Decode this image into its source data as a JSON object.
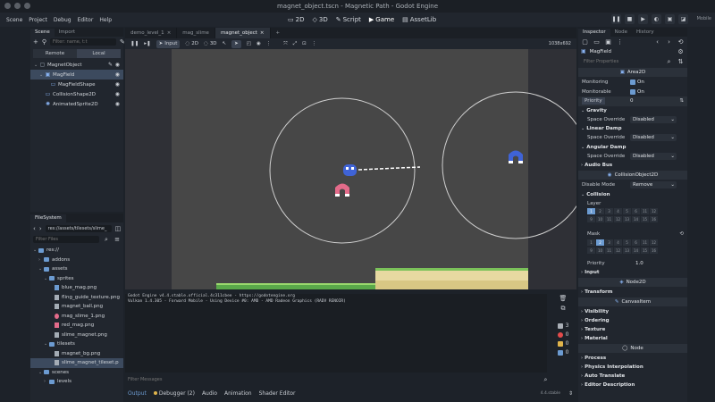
{
  "window": {
    "title": "magnet_object.tscn - Magnetic Path - Godot Engine"
  },
  "menu": [
    "Scene",
    "Project",
    "Debug",
    "Editor",
    "Help"
  ],
  "workspaces": [
    {
      "label": "2D",
      "icon": "2d-icon"
    },
    {
      "label": "3D",
      "icon": "3d-icon"
    },
    {
      "label": "Script",
      "icon": "script-icon"
    },
    {
      "label": "Game",
      "icon": "game-icon"
    },
    {
      "label": "AssetLib",
      "icon": "assetlib-icon"
    }
  ],
  "renderer": "Mobile",
  "scene_dock": {
    "tabs": [
      "Scene",
      "Import"
    ],
    "filter_placeholder": "Filter: name, t:t",
    "remote_label": "Remote",
    "local_label": "Local",
    "nodes": [
      {
        "name": "MagnetObject",
        "depth": 0,
        "icon_color": "#a8b3c2"
      },
      {
        "name": "MagField",
        "depth": 1,
        "icon_color": "#88b2f1"
      },
      {
        "name": "MagFieldShape",
        "depth": 2,
        "icon_color": "#88b2f1"
      },
      {
        "name": "CollisionShape2D",
        "depth": 1,
        "icon_color": "#88b2f1"
      },
      {
        "name": "AnimatedSprite2D",
        "depth": 1,
        "icon_color": "#88b2f1"
      }
    ]
  },
  "filesystem": {
    "tab": "FileSystem",
    "path": "res://assets/tilesets/slime_",
    "filter_placeholder": "Filter Files",
    "items": [
      {
        "name": "res://",
        "type": "folder",
        "depth": 0
      },
      {
        "name": "addons",
        "type": "folder",
        "depth": 1
      },
      {
        "name": "assets",
        "type": "folder",
        "depth": 1
      },
      {
        "name": "sprites",
        "type": "folder",
        "depth": 2
      },
      {
        "name": "blue_mag.png",
        "type": "file",
        "depth": 3
      },
      {
        "name": "fling_guide_texture.png",
        "type": "file",
        "depth": 3
      },
      {
        "name": "magnet_ball.png",
        "type": "file",
        "depth": 3
      },
      {
        "name": "mag_slime_1.png",
        "type": "file",
        "depth": 3
      },
      {
        "name": "red_mag.png",
        "type": "file",
        "depth": 3
      },
      {
        "name": "slime_magnet.png",
        "type": "file",
        "depth": 3
      },
      {
        "name": "tilesets",
        "type": "folder",
        "depth": 2
      },
      {
        "name": "magnet_bg.png",
        "type": "file",
        "depth": 3
      },
      {
        "name": "slime_magnet_tileset.p",
        "type": "file",
        "depth": 3
      },
      {
        "name": "scenes",
        "type": "folder",
        "depth": 1
      },
      {
        "name": "levels",
        "type": "folder",
        "depth": 2
      }
    ]
  },
  "editor_tabs": [
    "demo_level_1",
    "mag_slime",
    "magnet_object"
  ],
  "viewport_toolbar": {
    "input_label": "Input",
    "d2_label": "2D",
    "d3_label": "3D",
    "resolution": "1038x692"
  },
  "output": {
    "lines": [
      "Godot Engine v4.4.stable.official.4c311cbee - https://godotengine.org",
      "Vulkan 1.4.305 - Forward Mobile - Using Device #0: AMD - AMD Radeon Graphics (RADV RENOIR)"
    ],
    "filter_placeholder": "Filter Messages",
    "bottom_tabs": [
      "Output",
      "Debugger (2)",
      "Audio",
      "Animation",
      "Shader Editor"
    ],
    "version": "4.4.stable",
    "counters": [
      "3",
      "0",
      "0",
      "0"
    ]
  },
  "inspector": {
    "tabs": [
      "Inspector",
      "Node",
      "History"
    ],
    "object_name": "MagField",
    "filter_placeholder": "Filter Properties",
    "area_header": "Area2D",
    "monitoring_label": "Monitoring",
    "monitoring_value": "On",
    "monitorable_label": "Monitorable",
    "monitorable_value": "On",
    "priority_label": "Priority",
    "priority_value": "0",
    "gravity_label": "Gravity",
    "space_override_label": "Space Override",
    "disabled_value": "Disabled",
    "linear_damp_label": "Linear Damp",
    "angular_damp_label": "Angular Damp",
    "audio_bus_label": "Audio Bus",
    "collision_object_header": "CollisionObject2D",
    "disable_mode_label": "Disable Mode",
    "disable_mode_value": "Remove",
    "collision_label": "Collision",
    "layer_label": "Layer",
    "mask_label": "Mask",
    "layer_numbers_top": [
      "1",
      "2",
      "3",
      "4",
      "5",
      "6",
      "11",
      "12"
    ],
    "layer_numbers_bottom": [
      "9",
      "10",
      "11",
      "12",
      "13",
      "14",
      "15",
      "16"
    ],
    "priority2_label": "Priority",
    "priority2_value": "1.0",
    "input_label": "Input",
    "node2d_header": "Node2D",
    "transform_label": "Transform",
    "canvasitem_header": "CanvasItem",
    "visibility_label": "Visibility",
    "ordering_label": "Ordering",
    "texture_label": "Texture",
    "material_label": "Material",
    "node_header": "Node",
    "process_label": "Process",
    "physics_interp_label": "Physics Interpolation",
    "auto_translate_label": "Auto Translate",
    "editor_desc_label": "Editor Description"
  },
  "colors": {
    "accent": "#6c9bd1",
    "red_magnet": "#e36b8a",
    "blue_magnet": "#3f63d6",
    "grass": "#7bc25a",
    "sand": "#e7d9a1"
  }
}
